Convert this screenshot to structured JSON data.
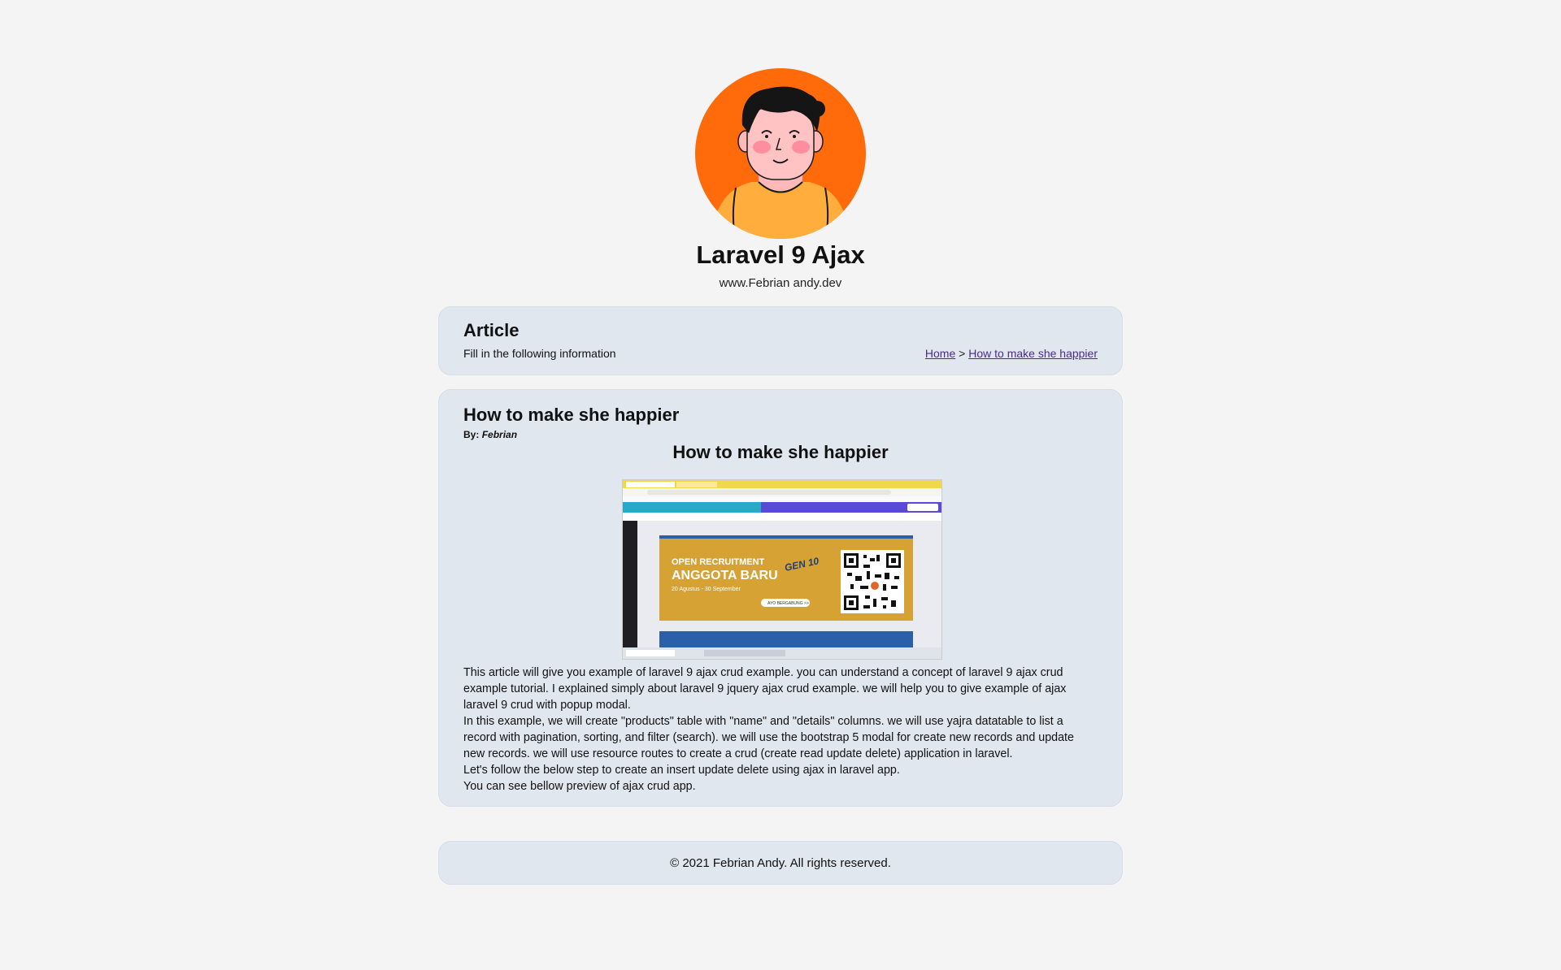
{
  "header": {
    "site_title": "Laravel 9 Ajax",
    "site_url": "www.Febrian andy.dev"
  },
  "page_header": {
    "title": "Article",
    "subtitle": "Fill in the following information",
    "breadcrumb": {
      "home": "Home",
      "separator": ">",
      "current": "How to make she happier"
    }
  },
  "article": {
    "title": "How to make she happier",
    "by_label": "By:",
    "author": "Febrian",
    "content_heading": "How to make she happier",
    "image_alt": "screenshot-open-recruitment",
    "image_texts": {
      "open_recruitment": "OPEN RECRUITMENT",
      "anggota_baru": "ANGGOTA BARU",
      "gen": "GEN 10",
      "dates": "20 Agustus - 30 September",
      "cta": "AYO BERGABUNG >>"
    },
    "paragraphs": [
      "This article will give you example of laravel 9 ajax crud example. you can understand a concept of laravel 9 ajax crud example tutorial. I explained simply about laravel 9 jquery ajax crud example. we will help you to give example of ajax laravel 9 crud with popup modal.",
      "In this example, we will create \"products\" table with \"name\" and \"details\" columns. we will use yajra datatable to list a record with pagination, sorting, and filter (search). we will use the bootstrap 5 modal for create new records and update new records. we will use resource routes to create a crud (create read update delete) application in laravel.",
      "Let's follow the below step to create an insert update delete using ajax in laravel app.",
      "You can see bellow preview of ajax crud app."
    ]
  },
  "footer": {
    "copyright": "© 2021 Febrian Andy. All rights reserved."
  },
  "colors": {
    "background": "#f4f4f4",
    "card": "#e1e7ef",
    "avatar_bg": "#ff6a0a",
    "link": "#4a2a8c",
    "banner": "#d6a233"
  }
}
